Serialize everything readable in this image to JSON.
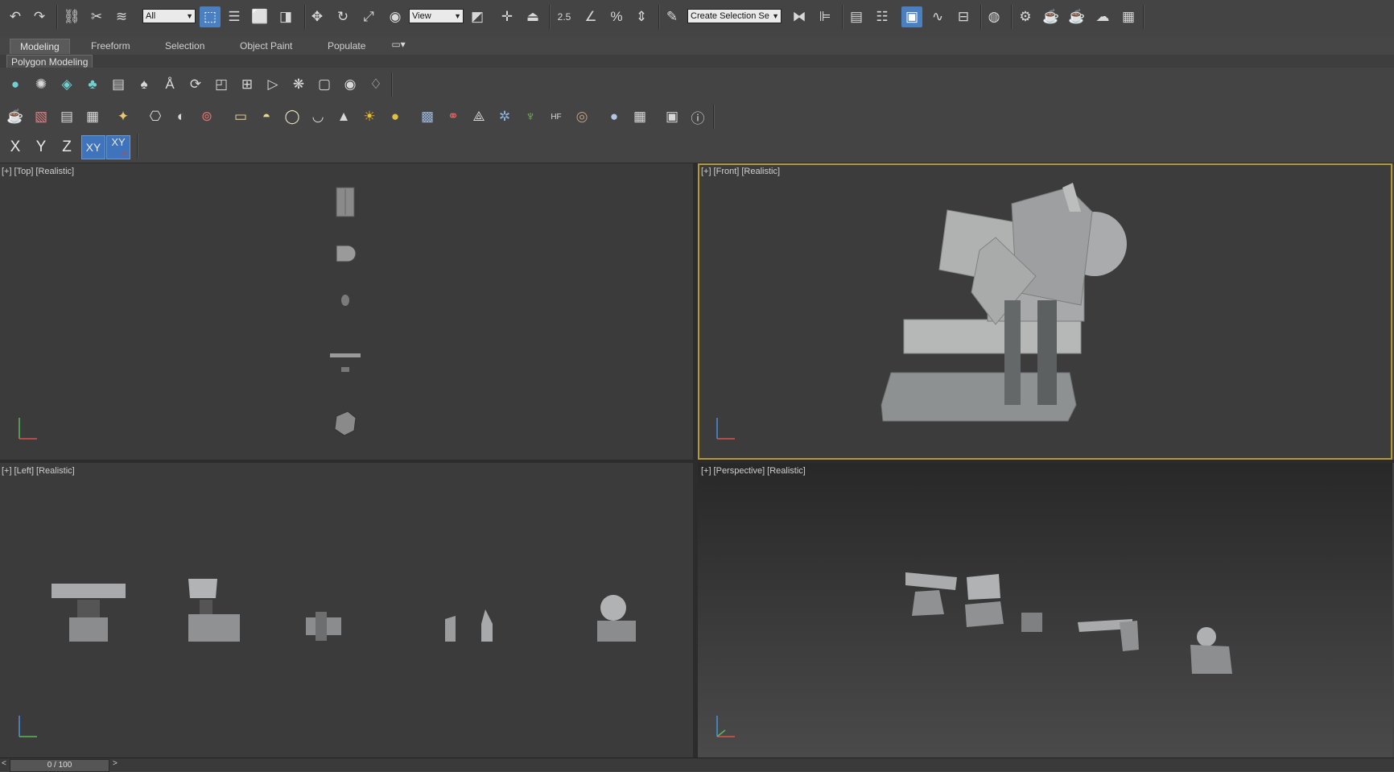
{
  "toolbar": {
    "selection_filter": "All",
    "reference_coord": "View",
    "snap_label": "2.5",
    "named_selection_placeholder": "Create Selection Se"
  },
  "ribbon": {
    "tabs": [
      {
        "label": "Modeling",
        "active": true
      },
      {
        "label": "Freeform",
        "active": false
      },
      {
        "label": "Selection",
        "active": false
      },
      {
        "label": "Object Paint",
        "active": false
      },
      {
        "label": "Populate",
        "active": false
      }
    ],
    "panel_label": "Polygon Modeling"
  },
  "axis_constraints": {
    "x": "X",
    "y": "Y",
    "z": "Z",
    "xy": "XY",
    "xy_snap": "XY"
  },
  "viewports": {
    "top": {
      "plus": "[+]",
      "view": "[Top]",
      "shading": "[Realistic]"
    },
    "front": {
      "plus": "[+]",
      "view": "[Front]",
      "shading": "[Realistic]"
    },
    "left": {
      "plus": "[+]",
      "view": "[Left]",
      "shading": "[Realistic]"
    },
    "perspective": {
      "plus": "[+]",
      "view": "[Perspective]",
      "shading": "[Realistic]"
    }
  },
  "timeline": {
    "frame_display": "0 / 100",
    "prev": "<",
    "next": ">"
  },
  "colors": {
    "active_viewport_border": "#b59a3a",
    "active_button": "#4a7fc0",
    "background": "#444444"
  }
}
